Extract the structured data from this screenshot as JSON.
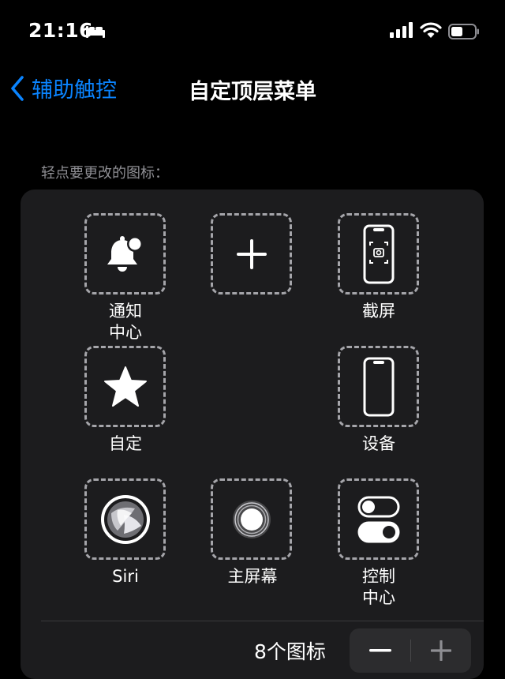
{
  "status": {
    "time": "21:16"
  },
  "nav": {
    "back_label": "辅助触控",
    "title": "自定顶层菜单"
  },
  "hint": "轻点要更改的图标：",
  "items": [
    {
      "label_1": "通知",
      "label_2": "中心"
    },
    {
      "label_1": "",
      "label_2": ""
    },
    {
      "label_1": "截屏",
      "label_2": ""
    },
    {
      "label_1": "自定",
      "label_2": ""
    },
    {
      "label_1": "设备",
      "label_2": ""
    },
    {
      "label_1": "Siri",
      "label_2": ""
    },
    {
      "label_1": "主屏幕",
      "label_2": ""
    },
    {
      "label_1": "控制",
      "label_2": "中心"
    }
  ],
  "footer": {
    "count_label": "8个图标"
  },
  "colors": {
    "accent": "#0a84ff",
    "card": "#1c1c1e",
    "dashed_border": "#a5a5aa"
  }
}
